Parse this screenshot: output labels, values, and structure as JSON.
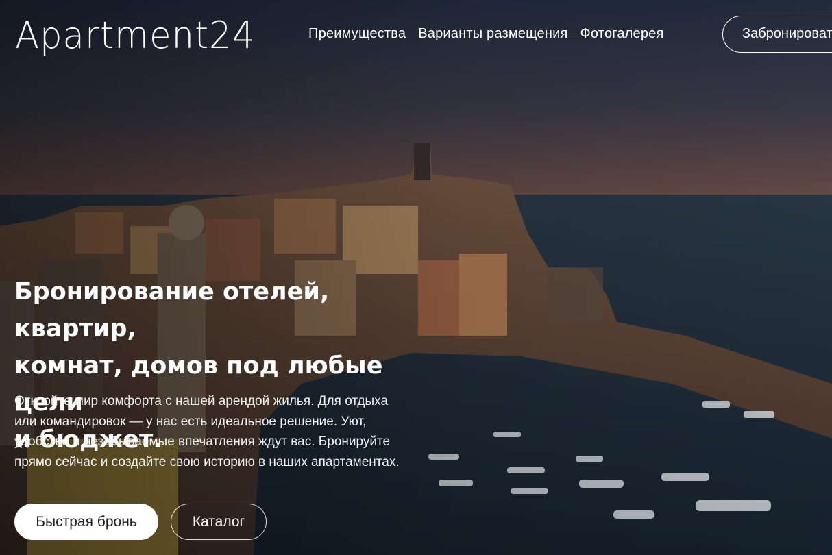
{
  "brand": {
    "logo": "Apartment24"
  },
  "nav": {
    "items": [
      {
        "label": "Преимущества"
      },
      {
        "label": "Варианты размещения"
      },
      {
        "label": "Фотогалерея"
      }
    ],
    "book_label": "Забронировать"
  },
  "hero": {
    "headline": "Бронирование отелей, квартир,\nкомнат, домов под любые цели\nи бюджет.",
    "description": "Откройте мир комфорта с нашей арендой жилья. Для отдыха\nили командировок — у нас есть идеальное решение. Уют,\nудобство и незабываемые впечатления ждут вас. Бронируйте\nпрямо сейчас и создайте свою историю в наших апартаментах.",
    "primary_button": "Быстрая бронь",
    "secondary_button": "Каталог",
    "background": "coastal-town-at-dusk-photo"
  },
  "colors": {
    "sky_top": "#2a3347",
    "sky_horizon": "#6b4e48",
    "sea": "#1e2c38",
    "text": "#ffffff",
    "button_primary_bg": "#ffffff",
    "button_primary_text": "#222222"
  }
}
